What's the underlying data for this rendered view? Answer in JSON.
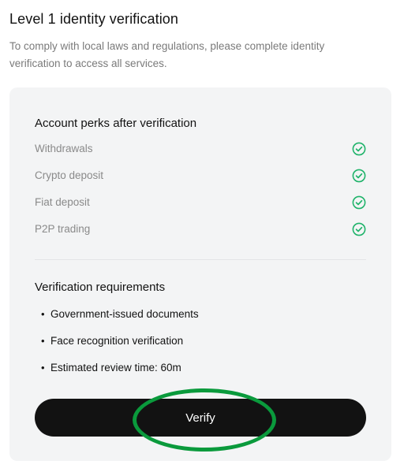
{
  "header": {
    "title": "Level 1 identity verification",
    "subtitle": "To comply with local laws and regulations, please complete identity verification to access all services."
  },
  "perks": {
    "heading": "Account perks after verification",
    "items": [
      {
        "label": "Withdrawals",
        "icon": "check-circle-icon"
      },
      {
        "label": "Crypto deposit",
        "icon": "check-circle-icon"
      },
      {
        "label": "Fiat deposit",
        "icon": "check-circle-icon"
      },
      {
        "label": "P2P trading",
        "icon": "check-circle-icon"
      }
    ]
  },
  "requirements": {
    "heading": "Verification requirements",
    "bullet": "•",
    "items": [
      "Government-issued documents",
      "Face recognition verification",
      "Estimated review time: 60m"
    ]
  },
  "actions": {
    "verify_label": "Verify"
  },
  "colors": {
    "check": "#1fb36a",
    "button_bg": "#121212",
    "card_bg": "#f3f4f5",
    "highlight": "#0a9a3c"
  }
}
